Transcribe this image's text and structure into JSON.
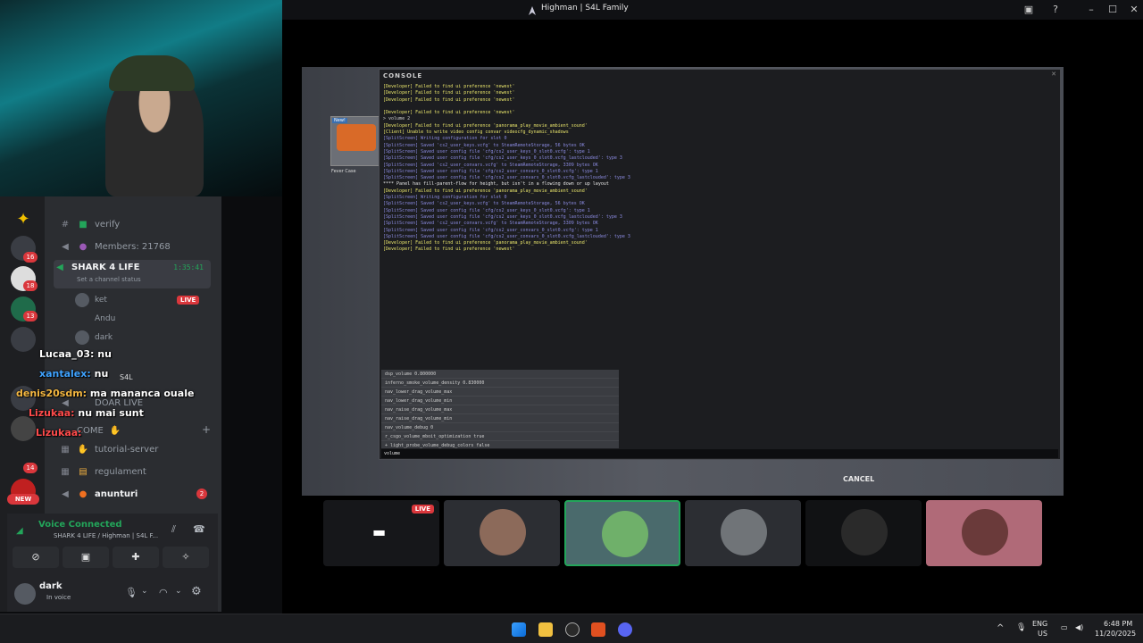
{
  "window": {
    "title": "Highman | S4L Family"
  },
  "channels": {
    "verify": "verify",
    "members": "Members: 21768",
    "shark_channel": "SHARK 4 LIFE",
    "shark_timer": "1:35:41",
    "channel_status": "Set a channel status",
    "voice_users": [
      "ket",
      "Andu",
      "dark"
    ],
    "live_badge": "LIVE",
    "s4l_tag": "S4L",
    "doar_live": "DOAR LIVE",
    "welcome": "COME",
    "tutorial": "tutorial-server",
    "regulament": "regulament",
    "anunturi": "anunturi",
    "anunturi_badge": "2"
  },
  "server_badges": [
    "16",
    "18",
    "13",
    "14",
    "NEW"
  ],
  "chat": [
    {
      "user": "Lucaa_03:",
      "msg": "nu",
      "color": "#ffffff"
    },
    {
      "user": "xantalex:",
      "msg": "nu",
      "color": "#3fa3ff"
    },
    {
      "user": "denis20sdm:",
      "msg": "ma mananca ouale",
      "color": "#f4b740"
    },
    {
      "user": "Lizukaa:",
      "msg": "nu mai sunt",
      "color": "#ff4b4b"
    },
    {
      "user": "Lizukaa:",
      "msg": "",
      "color": "#ff4b4b"
    }
  ],
  "voice": {
    "status": "Voice Connected",
    "channel": "SHARK 4 LIFE / Highman | S4L F..."
  },
  "user": {
    "name": "dark",
    "status": "In voice"
  },
  "console": {
    "title": "CONSOLE",
    "lines": [
      {
        "t": "[Developer] Failed to find ui preference 'newest'",
        "c": "#e6e26a"
      },
      {
        "t": "[Developer] Failed to find ui preference 'newest'",
        "c": "#e6e26a"
      },
      {
        "t": "[Developer] Failed to find ui preference 'newest'",
        "c": "#e6e26a"
      },
      {
        "t": "",
        "c": "#e04040"
      },
      {
        "t": "[Developer] Failed to find ui preference 'newest'",
        "c": "#e6e26a"
      },
      {
        "t": "> volume 2",
        "c": "#cfcfcf"
      },
      {
        "t": "[Developer] Failed to find ui preference 'panorama_play_movie_ambient_sound'",
        "c": "#e6e26a"
      },
      {
        "t": "[Client] Unable to write video config convar videocfg_dynamic_shadows",
        "c": "#e6e26a"
      },
      {
        "t": "[SplitScreen] Writing configuration for slot 0",
        "c": "#8a8adf"
      },
      {
        "t": "[SplitScreen] Saved 'cs2_user_keys.vcfg' to SteamRemoteStorage, 56 bytes OK",
        "c": "#8a8adf"
      },
      {
        "t": "[SplitScreen] Saved user config file 'cfg/cs2_user_keys_0_slot0.vcfg': type 1",
        "c": "#8a8adf"
      },
      {
        "t": "[SplitScreen] Saved user config file 'cfg/cs2_user_keys_0_slot0.vcfg_lastclouded': type 3",
        "c": "#8a8adf"
      },
      {
        "t": "[SplitScreen] Saved 'cs2_user_convars.vcfg' to SteamRemoteStorage, 3309 bytes OK",
        "c": "#8a8adf"
      },
      {
        "t": "[SplitScreen] Saved user config file 'cfg/cs2_user_convars_0_slot0.vcfg': type 1",
        "c": "#8a8adf"
      },
      {
        "t": "[SplitScreen] Saved user config file 'cfg/cs2_user_convars_0_slot0.vcfg_lastclouded': type 3",
        "c": "#8a8adf"
      },
      {
        "t": "**** Panel has fill-parent-flow for height, but isn't in a flowing down or up layout",
        "c": "#e6e6e6"
      },
      {
        "t": "[Developer] Failed to find ui preference 'panorama_play_movie_ambient_sound'",
        "c": "#e6e26a"
      },
      {
        "t": "[SplitScreen] Writing configuration for slot 0",
        "c": "#8a8adf"
      },
      {
        "t": "[SplitScreen] Saved 'cs2_user_keys.vcfg' to SteamRemoteStorage, 56 bytes OK",
        "c": "#8a8adf"
      },
      {
        "t": "[SplitScreen] Saved user config file 'cfg/cs2_user_keys_0_slot0.vcfg': type 1",
        "c": "#8a8adf"
      },
      {
        "t": "[SplitScreen] Saved user config file 'cfg/cs2_user_keys_0_slot0.vcfg_lastclouded': type 3",
        "c": "#8a8adf"
      },
      {
        "t": "[SplitScreen] Saved 'cs2_user_convars.vcfg' to SteamRemoteStorage, 3309 bytes OK",
        "c": "#8a8adf"
      },
      {
        "t": "[SplitScreen] Saved user config file 'cfg/cs2_user_convars_0_slot0.vcfg': type 1",
        "c": "#8a8adf"
      },
      {
        "t": "[SplitScreen] Saved user config file 'cfg/cs2_user_convars_0_slot0.vcfg_lastclouded': type 3",
        "c": "#8a8adf"
      },
      {
        "t": "[Developer] Failed to find ui preference 'panorama_play_movie_ambient_sound'",
        "c": "#e6e26a"
      },
      {
        "t": "[Developer] Failed to find ui preference 'newest'",
        "c": "#e6e26a"
      }
    ],
    "autocomplete": [
      "dsp_volume 0.800000",
      "inferno_smoke_volume_density 0.830000",
      "nav_lower_drag_volume_max",
      "nav_lower_drag_volume_min",
      "nav_raise_drag_volume_max",
      "nav_raise_drag_volume_min",
      "nav_volume_debug 0",
      "r_csgo_volume_mboit_optimization true",
      "+ light_probe_volume_debug_colors false"
    ],
    "input": "volume"
  },
  "case_card": {
    "badge": "New!",
    "name": "Fever Case"
  },
  "cancel": "CANCEL",
  "stream_live": "LIVE",
  "taskbar": {
    "lang": "ENG",
    "region": "US",
    "time": "6:48 PM",
    "date": "11/20/2025"
  },
  "colors": {
    "accent": "#5865f2",
    "danger": "#da373c",
    "voice_green": "#23a55a"
  }
}
